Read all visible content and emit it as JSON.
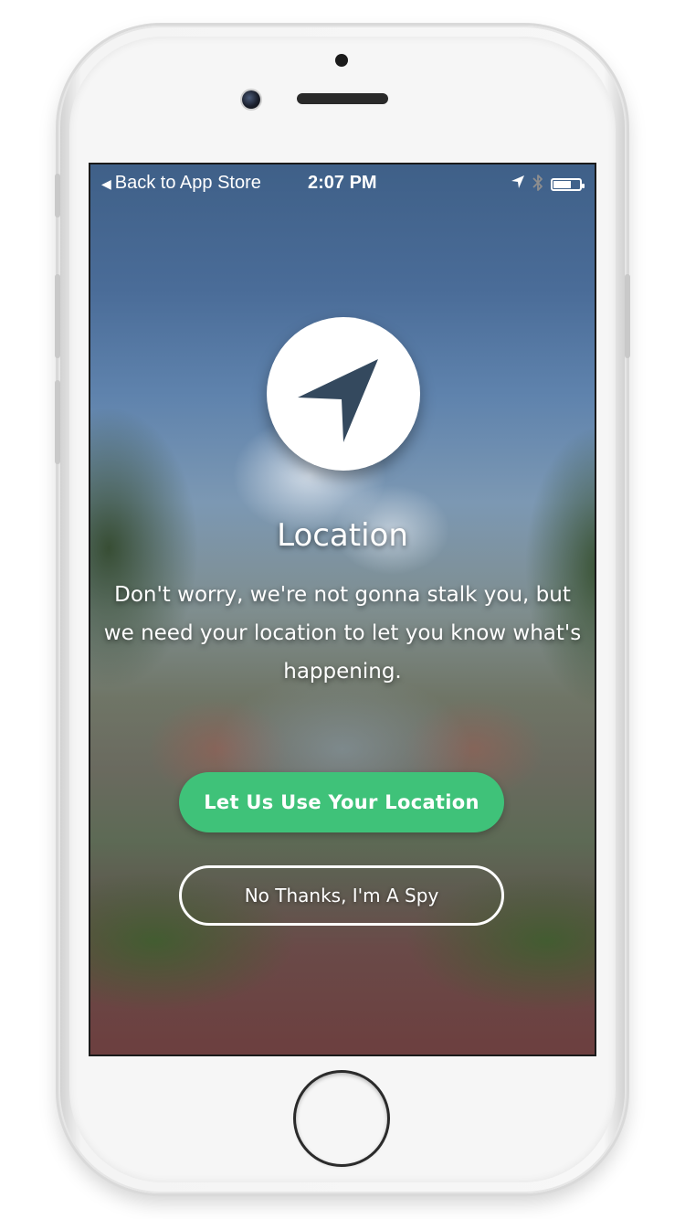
{
  "status_bar": {
    "back_label": "Back to App Store",
    "time": "2:07 PM",
    "icons": [
      "location-arrow-icon",
      "bluetooth-icon",
      "battery-icon"
    ]
  },
  "onboarding": {
    "icon": "navigation-arrow-icon",
    "title": "Location",
    "description": "Don't worry, we're not gonna stalk you, but we need your location to let you know what's happening.",
    "primary_button": "Let Us Use Your Location",
    "secondary_button": "No Thanks, I'm A Spy"
  },
  "colors": {
    "accent": "#3fc279",
    "text": "#ffffff"
  }
}
